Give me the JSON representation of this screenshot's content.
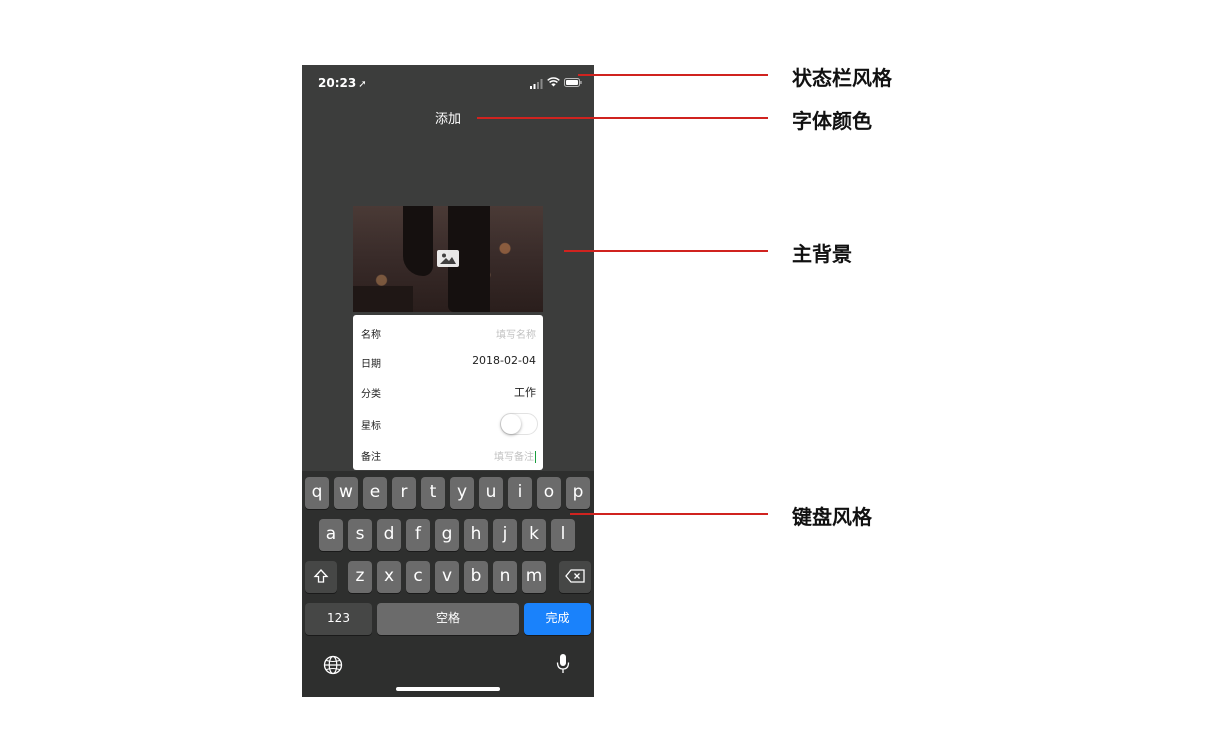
{
  "status_bar": {
    "time": "20:23",
    "location_arrow": "➚"
  },
  "nav": {
    "title": "添加"
  },
  "form": {
    "name_label": "名称",
    "name_placeholder": "填写名称",
    "date_label": "日期",
    "date_value": "2018-02-04",
    "category_label": "分类",
    "category_value": "工作",
    "star_label": "星标",
    "star_on": false,
    "note_label": "备注",
    "note_placeholder": "填写备注"
  },
  "keyboard": {
    "row1": [
      "q",
      "w",
      "e",
      "r",
      "t",
      "y",
      "u",
      "i",
      "o",
      "p"
    ],
    "row2": [
      "a",
      "s",
      "d",
      "f",
      "g",
      "h",
      "j",
      "k",
      "l"
    ],
    "row3": [
      "z",
      "x",
      "c",
      "v",
      "b",
      "n",
      "m"
    ],
    "numbers_label": "123",
    "space_label": "空格",
    "done_label": "完成",
    "done_color": "#1a82fb"
  },
  "annotations": {
    "status_bar_style": "状态栏风格",
    "font_color": "字体颜色",
    "main_background": "主背景",
    "keyboard_style": "键盘风格",
    "line_color": "#d0231f"
  }
}
